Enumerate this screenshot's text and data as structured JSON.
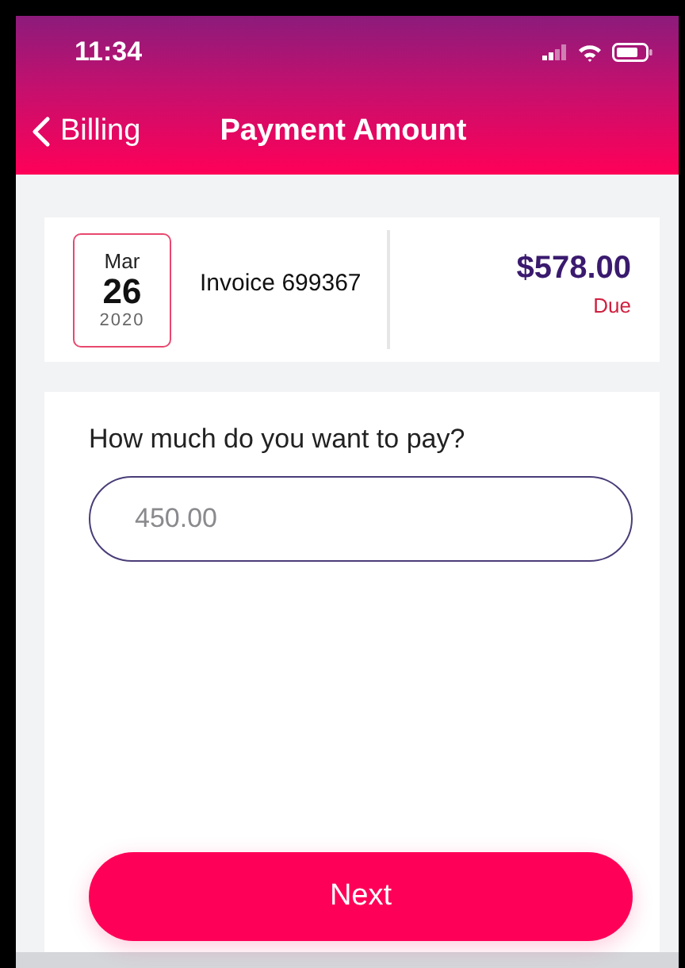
{
  "status_bar": {
    "time": "11:34"
  },
  "nav": {
    "back_label": "Billing",
    "title": "Payment Amount"
  },
  "invoice": {
    "month": "Mar",
    "day": "26",
    "year": "2020",
    "label": "Invoice 699367",
    "amount": "$578.00",
    "status": "Due"
  },
  "payment": {
    "question": "How much do you want to pay?",
    "amount_field": {
      "placeholder": "450.00"
    }
  },
  "buttons": [
    {
      "label": "Next"
    }
  ]
}
